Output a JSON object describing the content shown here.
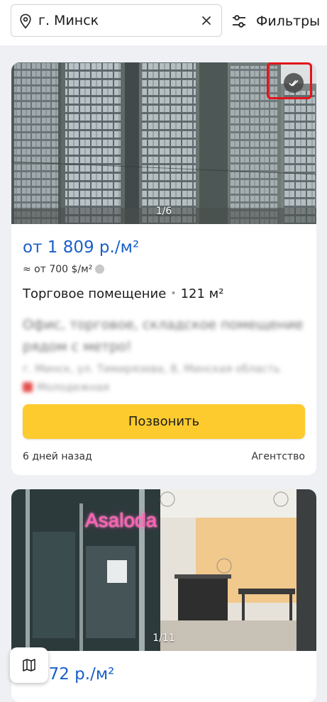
{
  "search": {
    "value": "г. Минск"
  },
  "filters": {
    "label": "Фильтры"
  },
  "listings": [
    {
      "photo_counter": "1/6",
      "price": "от 1 809 р./м²",
      "price_usd": "≈ от 700 $/м²",
      "type": "Торговое помещение",
      "area": "121 м²",
      "title_line1": "Офис, торговое, складское помещение",
      "title_line2": "рядом с метро!",
      "address": "г. Минск, ул. Тимирязева, 8, Минская область",
      "metro": "Молодежная",
      "call_label": "Позвонить",
      "date": "6 дней назад",
      "seller": "Агентство"
    },
    {
      "photo_counter": "1/11",
      "photo_sign": "Asaloda",
      "price": "2 972 р./м²"
    }
  ],
  "icons": {
    "location": "location-pin-icon",
    "clear": "close-icon",
    "filters": "sliders-icon",
    "viewed": "double-check-icon",
    "currency": "currency-info-icon",
    "map": "map-icon"
  },
  "colors": {
    "price": "#1a5fc9",
    "call_button": "#fecb2e",
    "highlight": "#e3141a"
  }
}
